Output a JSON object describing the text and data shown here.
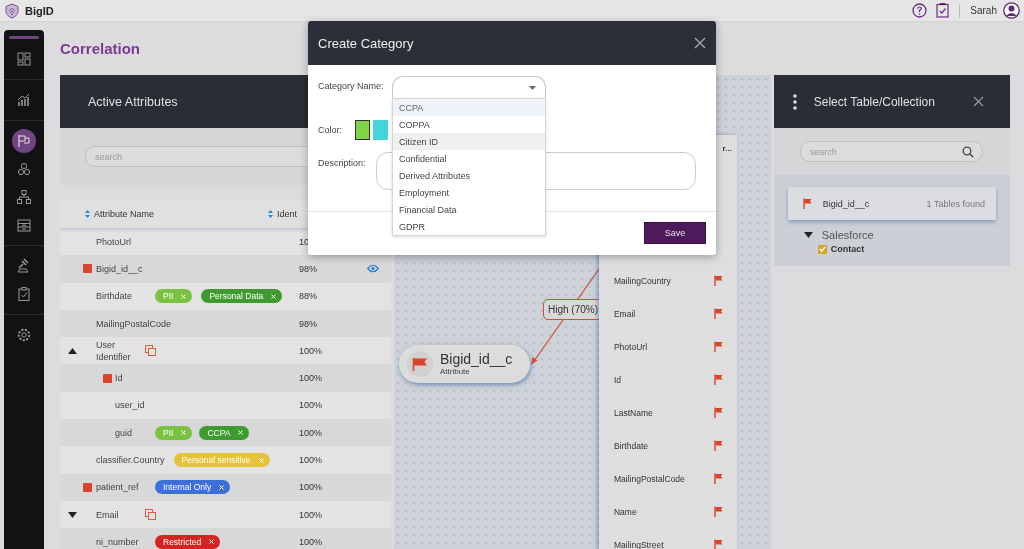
{
  "topbar": {
    "brand": "BigID",
    "user": "Sarah"
  },
  "sidebar": {
    "items": [
      {
        "kind": "dashboard",
        "selected": false
      },
      {
        "kind": "chart",
        "selected": false
      },
      {
        "kind": "flag",
        "selected": true
      },
      {
        "kind": "circles",
        "selected": false
      },
      {
        "kind": "hierarchy",
        "selected": false
      },
      {
        "kind": "cabinet",
        "selected": false
      },
      {
        "kind": "gavel",
        "selected": false
      },
      {
        "kind": "clipboard",
        "selected": false
      },
      {
        "kind": "settings",
        "selected": false
      }
    ]
  },
  "page_title": "Correlation",
  "attributes": {
    "title": "Active Attributes",
    "search_placeholder": "search",
    "columns": [
      "Attribute Name",
      "Ident"
    ],
    "rows": [
      {
        "name": "PhotoUrl",
        "score": "10",
        "flagged": false,
        "preview": false
      },
      {
        "name": "Bigid_id__c",
        "score": "98%",
        "flagged": true,
        "preview": true
      },
      {
        "name": "Birthdate",
        "score": "88%",
        "flagged": false,
        "preview": false,
        "tags": [
          {
            "label": "PII",
            "color": "#7cc242"
          },
          {
            "label": "Personal Data",
            "color": "#3f9a30"
          }
        ]
      },
      {
        "name": "MailingPostalCode",
        "score": "98%",
        "flagged": false,
        "preview": false
      },
      {
        "name": "User Identifier",
        "score": "100%",
        "flagged": false,
        "preview": false,
        "expanded": true,
        "children": [
          {
            "name": "Id",
            "score": "100%",
            "flagged": true,
            "preview": false
          },
          {
            "name": "user_id",
            "score": "100%",
            "flagged": false,
            "preview": false
          },
          {
            "name": "guid",
            "score": "100%",
            "flagged": false,
            "preview": false,
            "tags": [
              {
                "label": "PII",
                "color": "#7cc242"
              },
              {
                "label": "CCPA",
                "color": "#3f9a30"
              }
            ]
          }
        ]
      },
      {
        "name": "classifier.Country",
        "score": "100%",
        "flagged": false,
        "preview": false,
        "tags": [
          {
            "label": "Personal sensitive",
            "color": "#e6c23a"
          }
        ]
      },
      {
        "name": "patient_ref",
        "score": "100%",
        "flagged": true,
        "preview": false,
        "tags": [
          {
            "label": "Internal Only",
            "color": "#3d6fd8"
          }
        ]
      },
      {
        "name": "Email",
        "score": "100%",
        "flagged": false,
        "preview": false,
        "expanded": false
      },
      {
        "name": "ni_number",
        "score": "100%",
        "flagged": false,
        "preview": false,
        "tags": [
          {
            "label": "Restricted",
            "color": "#d42420"
          }
        ]
      }
    ]
  },
  "graph": {
    "node": {
      "name": "Bigid_id__c",
      "type": "Attribute"
    },
    "edge_label": "High (70%)",
    "column": {
      "title": "r...",
      "items": [
        "MailingCountry",
        "Email",
        "PhotoUrl",
        "Id",
        "LastName",
        "Birthdate",
        "MailingPostalCode",
        "Name",
        "MailingStreet"
      ]
    }
  },
  "table_panel": {
    "title": "Select Table/Collection",
    "search_placeholder": "search",
    "result": {
      "name": "Bigid_id__c",
      "count": "1 Tables found"
    },
    "source": {
      "name": "Salesforce",
      "expanded": true,
      "items": [
        {
          "name": "Contact",
          "checked": true
        }
      ]
    }
  },
  "dialog": {
    "title": "Create Category",
    "name_label": "Category Name:",
    "options": [
      {
        "label": "CCPA",
        "selected": true,
        "hovered": false
      },
      {
        "label": "COPPA",
        "selected": false,
        "hovered": false
      },
      {
        "label": "Citizen ID",
        "selected": false,
        "hovered": true
      },
      {
        "label": "Confidential",
        "selected": false,
        "hovered": false
      },
      {
        "label": "Derived Attributes",
        "selected": false,
        "hovered": false
      },
      {
        "label": "Employment",
        "selected": false,
        "hovered": false
      },
      {
        "label": "Financial Data",
        "selected": false,
        "hovered": false
      },
      {
        "label": "GDPR",
        "selected": false,
        "hovered": false
      }
    ],
    "color_label": "Color:",
    "colors": [
      {
        "color": "#7ed348",
        "selected": true
      },
      {
        "color": "#45d3dc",
        "selected": false
      }
    ],
    "description_label": "Description:",
    "save": "Save"
  }
}
